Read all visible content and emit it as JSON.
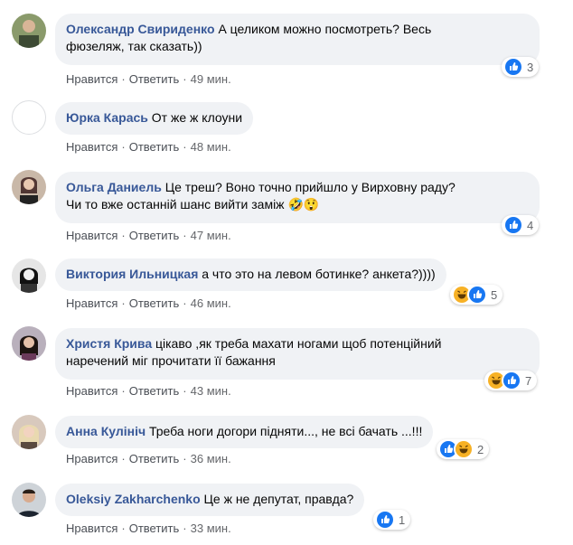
{
  "actions": {
    "like": "Нравится",
    "reply": "Ответить",
    "sep": "·"
  },
  "colors": {
    "author": "#385898",
    "bubble": "#f0f2f5",
    "like": "#1877f2",
    "haha": "#f7b125"
  },
  "comments": [
    {
      "author": "Олександр Свириденко",
      "text1": "А целиком можно посмотреть? Весь",
      "text2": "фюзеляж, так сказать))",
      "time": "49 мин.",
      "reactions": [
        "like-icon"
      ],
      "count": "3"
    },
    {
      "author": "Юрка Карась",
      "text1": "От же ж клоуни",
      "time": "48 мин."
    },
    {
      "author": "Ольга Даниель",
      "text1": "Це треш? Воно точно прийшло у Вирховну раду?",
      "text2": "Чи то вже останній шанс вийти заміж",
      "emoji": "🤣😲",
      "time": "47 мин.",
      "reactions": [
        "like-icon"
      ],
      "count": "4"
    },
    {
      "author": "Виктория Ильницкая",
      "text1": "а что это на левом ботинке? анкета?))))",
      "time": "46 мин.",
      "reactions": [
        "haha-icon",
        "like-icon"
      ],
      "count": "5"
    },
    {
      "author": "Христя Крива",
      "text1": "цікаво ,як треба махати ногами щоб потенційний",
      "text2": "наречений міг прочитати її бажання",
      "time": "43 мин.",
      "reactions": [
        "haha-icon",
        "like-icon"
      ],
      "count": "7"
    },
    {
      "author": "Анна Кулініч",
      "text1": "Треба ноги догори підняти..., не всі бачать ...!!!",
      "time": "36 мин.",
      "reactions": [
        "like-icon",
        "haha-icon"
      ],
      "count": "2"
    },
    {
      "author": "Oleksiy Zakharchenko",
      "text1": "Це ж не депутат, правда?",
      "time": "33 мин.",
      "reactions": [
        "like-icon"
      ],
      "count": "1"
    }
  ]
}
